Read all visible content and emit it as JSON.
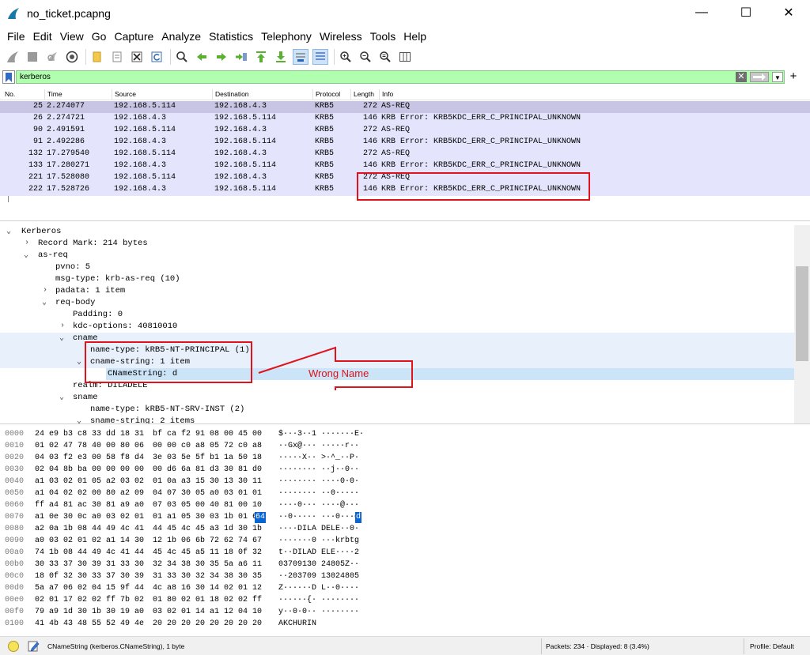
{
  "window": {
    "title": "no_ticket.pcapng",
    "controls": {
      "minimize": "—",
      "maximize": "☐",
      "close": "✕"
    }
  },
  "menu": [
    "File",
    "Edit",
    "View",
    "Go",
    "Capture",
    "Analyze",
    "Statistics",
    "Telephony",
    "Wireless",
    "Tools",
    "Help"
  ],
  "toolbar": {
    "icons": [
      "shark-fin-start-icon",
      "stop-capture-icon",
      "restart-capture-icon",
      "capture-options-icon",
      "open-file-icon",
      "file-set-icon",
      "close-file-icon",
      "reload-icon",
      "find-packet-icon",
      "go-back-icon",
      "go-forward-icon",
      "go-to-packet-icon",
      "go-first-icon",
      "go-last-icon",
      "autoscroll-icon",
      "colorize-icon",
      "zoom-in-icon",
      "zoom-out-icon",
      "zoom-normal-icon",
      "resize-columns-icon"
    ]
  },
  "filter": {
    "value": "kerberos",
    "accent": "#afffaf"
  },
  "packet_list": {
    "columns": [
      "No.",
      "Time",
      "Source",
      "Destination",
      "Protocol",
      "Length",
      "Info"
    ],
    "rows": [
      {
        "no": "25",
        "time": "2.274077",
        "source": "192.168.5.114",
        "destination": "192.168.4.3",
        "protocol": "KRB5",
        "length": "272",
        "info": "AS-REQ"
      },
      {
        "no": "26",
        "time": "2.274721",
        "source": "192.168.4.3",
        "destination": "192.168.5.114",
        "protocol": "KRB5",
        "length": "146",
        "info": "KRB Error: KRB5KDC_ERR_C_PRINCIPAL_UNKNOWN"
      },
      {
        "no": "90",
        "time": "2.491591",
        "source": "192.168.5.114",
        "destination": "192.168.4.3",
        "protocol": "KRB5",
        "length": "272",
        "info": "AS-REQ"
      },
      {
        "no": "91",
        "time": "2.492286",
        "source": "192.168.4.3",
        "destination": "192.168.5.114",
        "protocol": "KRB5",
        "length": "146",
        "info": "KRB Error: KRB5KDC_ERR_C_PRINCIPAL_UNKNOWN"
      },
      {
        "no": "132",
        "time": "17.279540",
        "source": "192.168.5.114",
        "destination": "192.168.4.3",
        "protocol": "KRB5",
        "length": "272",
        "info": "AS-REQ"
      },
      {
        "no": "133",
        "time": "17.280271",
        "source": "192.168.4.3",
        "destination": "192.168.5.114",
        "protocol": "KRB5",
        "length": "146",
        "info": "KRB Error: KRB5KDC_ERR_C_PRINCIPAL_UNKNOWN"
      },
      {
        "no": "221",
        "time": "17.528080",
        "source": "192.168.5.114",
        "destination": "192.168.4.3",
        "protocol": "KRB5",
        "length": "272",
        "info": "AS-REQ"
      },
      {
        "no": "222",
        "time": "17.528726",
        "source": "192.168.4.3",
        "destination": "192.168.5.114",
        "protocol": "KRB5",
        "length": "146",
        "info": "KRB Error: KRB5KDC_ERR_C_PRINCIPAL_UNKNOWN"
      }
    ],
    "selected_no": "25",
    "row_color": "#e4e4fc",
    "selected_color": "#c7c5e3"
  },
  "details": {
    "rows": [
      "Kerberos",
      "Record Mark: 214 bytes",
      "as-req",
      "pvno: 5",
      "msg-type: krb-as-req (10)",
      "padata: 1 item",
      "req-body",
      "Padding: 0",
      "kdc-options: 40810010",
      "cname",
      "name-type: kRB5-NT-PRINCIPAL (1)",
      "cname-string: 1 item",
      "CNameString: d",
      "realm: DILADELE",
      "sname",
      "name-type: kRB5-NT-SRV-INST (2)",
      "sname-string: 2 items"
    ]
  },
  "bytes": {
    "rows": [
      {
        "off": "0000",
        "a": "24 e9 b3 c8 33 dd 18 31",
        "b": "bf ca f2 91 08 00 45 00",
        "asc": "$···3··1 ·······E·"
      },
      {
        "off": "0010",
        "a": "01 02 47 78 40 00 80 06",
        "b": "00 00 c0 a8 05 72 c0 a8",
        "asc": "··Gx@··· ·····r··"
      },
      {
        "off": "0020",
        "a": "04 03 f2 e3 00 58 f8 d4",
        "b": "3e 03 5e 5f b1 1a 50 18",
        "asc": "·····X·· >·^_··P·"
      },
      {
        "off": "0030",
        "a": "02 04 8b ba 00 00 00 00",
        "b": "00 d6 6a 81 d3 30 81 d0",
        "asc": "········ ··j··0··"
      },
      {
        "off": "0040",
        "a": "a1 03 02 01 05 a2 03 02",
        "b": "01 0a a3 15 30 13 30 11",
        "asc": "········ ····0·0·"
      },
      {
        "off": "0050",
        "a": "a1 04 02 02 00 80 a2 09",
        "b": "04 07 30 05 a0 03 01 01",
        "asc": "········ ··0·····"
      },
      {
        "off": "0060",
        "a": "ff a4 81 ac 30 81 a9 a0",
        "b": "07 03 05 00 40 81 00 10",
        "asc": "····0··· ····@···"
      },
      {
        "off": "0070",
        "a": "a1 0e 30 0c a0 03 02 01",
        "b": "01 a1 05 30 03 1b 01 64",
        "asc": "··0····· ···0···d"
      },
      {
        "off": "0080",
        "a": "a2 0a 1b 08 44 49 4c 41",
        "b": "44 45 4c 45 a3 1d 30 1b",
        "asc": "····DILA DELE··0·"
      },
      {
        "off": "0090",
        "a": "a0 03 02 01 02 a1 14 30",
        "b": "12 1b 06 6b 72 62 74 67",
        "asc": "·······0 ···krbtg"
      },
      {
        "off": "00a0",
        "a": "74 1b 08 44 49 4c 41 44",
        "b": "45 4c 45 a5 11 18 0f 32",
        "asc": "t··DILAD ELE····2"
      },
      {
        "off": "00b0",
        "a": "30 33 37 30 39 31 33 30",
        "b": "32 34 38 30 35 5a a6 11",
        "asc": "03709130 24805Z··"
      },
      {
        "off": "00c0",
        "a": "18 0f 32 30 33 37 30 39",
        "b": "31 33 30 32 34 38 30 35",
        "asc": "··203709 13024805"
      },
      {
        "off": "00d0",
        "a": "5a a7 06 02 04 15 9f 44",
        "b": "4c a8 16 30 14 02 01 12",
        "asc": "Z······D L··0····"
      },
      {
        "off": "00e0",
        "a": "02 01 17 02 02 ff 7b 02",
        "b": "01 80 02 01 18 02 02 ff",
        "asc": "······{· ········"
      },
      {
        "off": "00f0",
        "a": "79 a9 1d 30 1b 30 19 a0",
        "b": "03 02 01 14 a1 12 04 10",
        "asc": "y··0·0·· ········"
      },
      {
        "off": "0100",
        "a": "41 4b 43 48 55 52 49 4e",
        "b": "20 20 20 20 20 20 20 20",
        "asc": "AKCHURIN"
      }
    ],
    "highlight_byte": "64",
    "highlight_ascii": "d",
    "highlight_color": "#0a64d2"
  },
  "statusbar": {
    "field": "CNameString (kerberos.CNameString), 1 byte",
    "packets": "Packets: 234 · Displayed: 8 (3.4%)",
    "profile": "Profile: Default"
  },
  "annotation": {
    "label": "Wrong Name",
    "color": "#e0121b"
  }
}
